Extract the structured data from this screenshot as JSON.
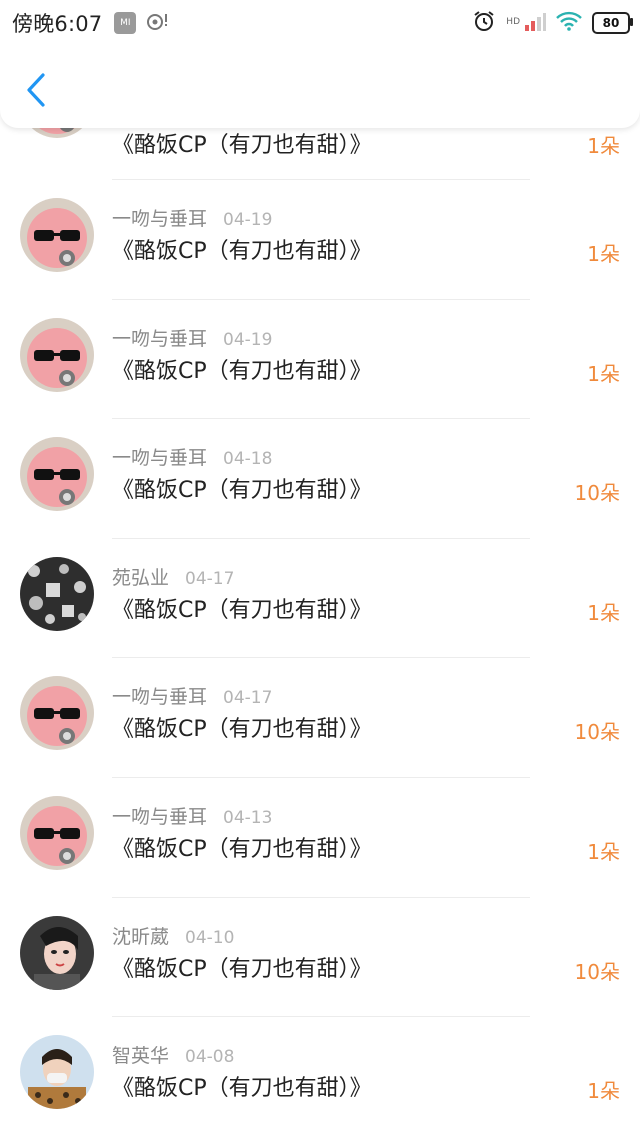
{
  "status_bar": {
    "time": "傍晚6:07",
    "mi_label": "MI",
    "hd_label": "HD",
    "battery": "80"
  },
  "colors": {
    "accent": "#2196f3",
    "amount": "#f08a3c"
  },
  "first_row": {
    "title": "《酪饭CP（有刀也有甜）》",
    "amount": "1朵"
  },
  "rows": [
    {
      "username": "一吻与垂耳",
      "date": "04-19",
      "title": "《酪饭CP（有刀也有甜）》",
      "amount": "1朵"
    },
    {
      "username": "一吻与垂耳",
      "date": "04-19",
      "title": "《酪饭CP（有刀也有甜）》",
      "amount": "1朵"
    },
    {
      "username": "一吻与垂耳",
      "date": "04-18",
      "title": "《酪饭CP（有刀也有甜）》",
      "amount": "10朵"
    },
    {
      "username": "苑弘业",
      "date": "04-17",
      "title": "《酪饭CP（有刀也有甜）》",
      "amount": "1朵"
    },
    {
      "username": "一吻与垂耳",
      "date": "04-17",
      "title": "《酪饭CP（有刀也有甜）》",
      "amount": "10朵"
    },
    {
      "username": "一吻与垂耳",
      "date": "04-13",
      "title": "《酪饭CP（有刀也有甜）》",
      "amount": "1朵"
    },
    {
      "username": "沈昕葳",
      "date": "04-10",
      "title": "《酪饭CP（有刀也有甜）》",
      "amount": "10朵"
    },
    {
      "username": "智英华",
      "date": "04-08",
      "title": "《酪饭CP（有刀也有甜）》",
      "amount": "1朵"
    }
  ]
}
